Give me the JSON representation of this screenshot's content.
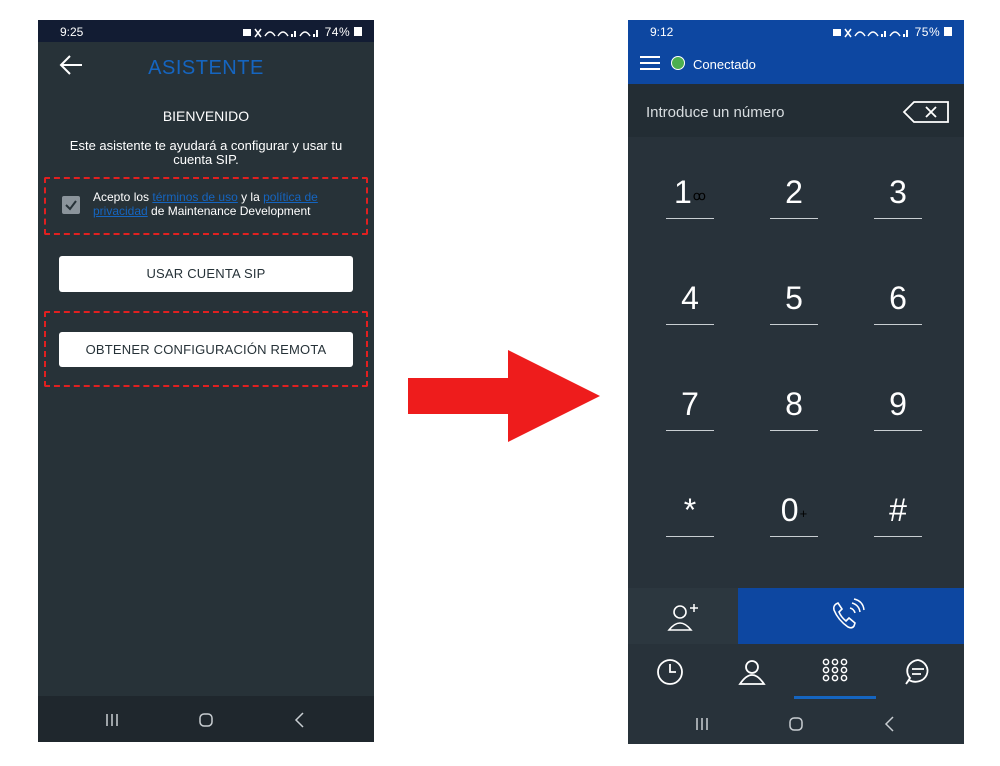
{
  "left_phone": {
    "status": {
      "time": "9:25",
      "battery": "74%"
    },
    "title": "ASISTENTE",
    "welcome": "BIENVENIDO",
    "description": "Este asistente te ayudará a configurar y usar tu cuenta SIP.",
    "terms": {
      "prefix": "Acepto los ",
      "link1": "términos de uso",
      "middle": " y la ",
      "link2": "política de privacidad",
      "suffix": " de Maintenance Development",
      "checked": true
    },
    "buttons": {
      "sip": "USAR CUENTA SIP",
      "remote": "OBTENER CONFIGURACIÓN REMOTA"
    },
    "colors": {
      "accent": "#1565c0",
      "highlight": "#e02020"
    }
  },
  "right_phone": {
    "status": {
      "time": "9:12",
      "battery": "75%"
    },
    "connection": "Conectado",
    "input_placeholder": "Introduce un número",
    "keys": [
      {
        "digit": "1",
        "sub": "ꝏ"
      },
      {
        "digit": "2",
        "sub": ""
      },
      {
        "digit": "3",
        "sub": ""
      },
      {
        "digit": "4",
        "sub": ""
      },
      {
        "digit": "5",
        "sub": ""
      },
      {
        "digit": "6",
        "sub": ""
      },
      {
        "digit": "7",
        "sub": ""
      },
      {
        "digit": "8",
        "sub": ""
      },
      {
        "digit": "9",
        "sub": ""
      },
      {
        "digit": "*",
        "sub": ""
      },
      {
        "digit": "0",
        "sub": "+"
      },
      {
        "digit": "#",
        "sub": ""
      }
    ],
    "colors": {
      "primary": "#0d47a1",
      "status": "#4caf50"
    }
  }
}
